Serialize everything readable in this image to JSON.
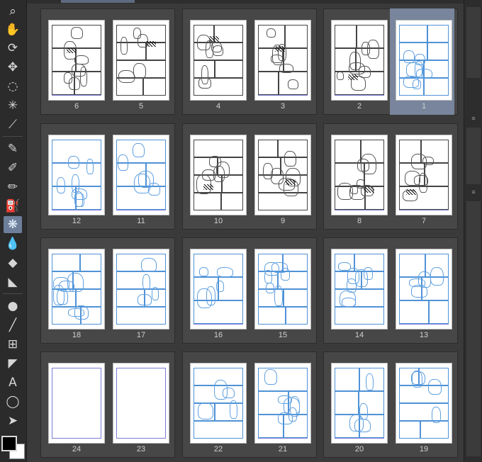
{
  "toolbar": {
    "tools": [
      {
        "name": "zoom-icon",
        "glyph": "⌕"
      },
      {
        "name": "hand-icon",
        "glyph": "✋"
      },
      {
        "name": "rotate-icon",
        "glyph": "⟳"
      },
      {
        "name": "move-icon",
        "glyph": "✥"
      },
      {
        "name": "lasso-select-icon",
        "glyph": "◌"
      },
      {
        "name": "magic-wand-icon",
        "glyph": "✳"
      },
      {
        "name": "eyedropper-icon",
        "glyph": "⟋"
      },
      {
        "name": "pen-icon",
        "glyph": "✎"
      },
      {
        "name": "pencil-icon",
        "glyph": "✐"
      },
      {
        "name": "brush-icon",
        "glyph": "✏"
      },
      {
        "name": "airbrush-icon",
        "glyph": "⛽"
      },
      {
        "name": "decoration-icon",
        "glyph": "❋"
      },
      {
        "name": "blend-icon",
        "glyph": "💧"
      },
      {
        "name": "eraser-icon",
        "glyph": "◆"
      },
      {
        "name": "fill-icon",
        "glyph": "◣"
      },
      {
        "name": "shape-icon",
        "glyph": "●"
      },
      {
        "name": "line-icon",
        "glyph": "╱"
      },
      {
        "name": "frame-border-icon",
        "glyph": "⊞"
      },
      {
        "name": "ruler-icon",
        "glyph": "◤"
      },
      {
        "name": "text-icon",
        "glyph": "A"
      },
      {
        "name": "balloon-icon",
        "glyph": "◯"
      },
      {
        "name": "object-select-icon",
        "glyph": "➤"
      }
    ],
    "active_tool": "decoration-icon",
    "colors": {
      "main": "#000000",
      "sub": "#ffffff",
      "active_highlight": "#6d7f9a"
    }
  },
  "pages": [
    {
      "number": "6",
      "style": "ink"
    },
    {
      "number": "5",
      "style": "ink"
    },
    {
      "number": "4",
      "style": "ink"
    },
    {
      "number": "3",
      "style": "ink"
    },
    {
      "number": "2",
      "style": "ink"
    },
    {
      "number": "1",
      "style": "sketch",
      "selected": true
    },
    {
      "number": "12",
      "style": "sketch"
    },
    {
      "number": "11",
      "style": "sketch"
    },
    {
      "number": "10",
      "style": "ink"
    },
    {
      "number": "9",
      "style": "ink"
    },
    {
      "number": "8",
      "style": "ink"
    },
    {
      "number": "7",
      "style": "ink"
    },
    {
      "number": "18",
      "style": "sketch"
    },
    {
      "number": "17",
      "style": "sketch"
    },
    {
      "number": "16",
      "style": "sketch"
    },
    {
      "number": "15",
      "style": "sketch"
    },
    {
      "number": "14",
      "style": "sketch"
    },
    {
      "number": "13",
      "style": "sketch"
    },
    {
      "number": "24",
      "style": "blank"
    },
    {
      "number": "23",
      "style": "blank"
    },
    {
      "number": "22",
      "style": "sketch"
    },
    {
      "number": "21",
      "style": "sketch"
    },
    {
      "number": "20",
      "style": "sketch"
    },
    {
      "number": "19",
      "style": "sketch"
    }
  ]
}
